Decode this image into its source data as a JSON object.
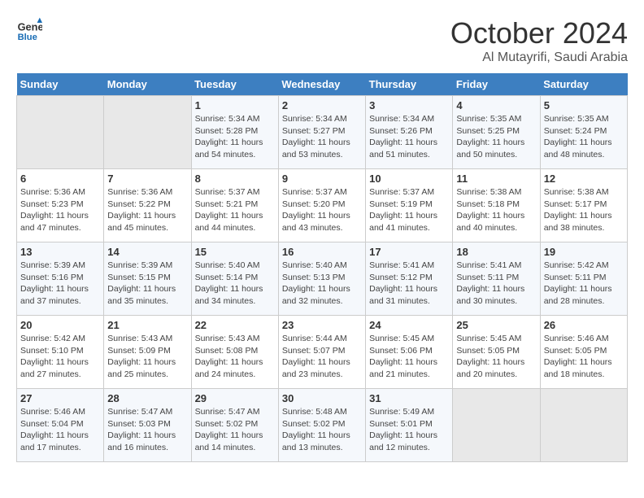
{
  "header": {
    "logo_line1": "General",
    "logo_line2": "Blue",
    "month_title": "October 2024",
    "location": "Al Mutayrifi, Saudi Arabia"
  },
  "days_of_week": [
    "Sunday",
    "Monday",
    "Tuesday",
    "Wednesday",
    "Thursday",
    "Friday",
    "Saturday"
  ],
  "weeks": [
    [
      {
        "num": "",
        "info": ""
      },
      {
        "num": "",
        "info": ""
      },
      {
        "num": "1",
        "info": "Sunrise: 5:34 AM\nSunset: 5:28 PM\nDaylight: 11 hours and 54 minutes."
      },
      {
        "num": "2",
        "info": "Sunrise: 5:34 AM\nSunset: 5:27 PM\nDaylight: 11 hours and 53 minutes."
      },
      {
        "num": "3",
        "info": "Sunrise: 5:34 AM\nSunset: 5:26 PM\nDaylight: 11 hours and 51 minutes."
      },
      {
        "num": "4",
        "info": "Sunrise: 5:35 AM\nSunset: 5:25 PM\nDaylight: 11 hours and 50 minutes."
      },
      {
        "num": "5",
        "info": "Sunrise: 5:35 AM\nSunset: 5:24 PM\nDaylight: 11 hours and 48 minutes."
      }
    ],
    [
      {
        "num": "6",
        "info": "Sunrise: 5:36 AM\nSunset: 5:23 PM\nDaylight: 11 hours and 47 minutes."
      },
      {
        "num": "7",
        "info": "Sunrise: 5:36 AM\nSunset: 5:22 PM\nDaylight: 11 hours and 45 minutes."
      },
      {
        "num": "8",
        "info": "Sunrise: 5:37 AM\nSunset: 5:21 PM\nDaylight: 11 hours and 44 minutes."
      },
      {
        "num": "9",
        "info": "Sunrise: 5:37 AM\nSunset: 5:20 PM\nDaylight: 11 hours and 43 minutes."
      },
      {
        "num": "10",
        "info": "Sunrise: 5:37 AM\nSunset: 5:19 PM\nDaylight: 11 hours and 41 minutes."
      },
      {
        "num": "11",
        "info": "Sunrise: 5:38 AM\nSunset: 5:18 PM\nDaylight: 11 hours and 40 minutes."
      },
      {
        "num": "12",
        "info": "Sunrise: 5:38 AM\nSunset: 5:17 PM\nDaylight: 11 hours and 38 minutes."
      }
    ],
    [
      {
        "num": "13",
        "info": "Sunrise: 5:39 AM\nSunset: 5:16 PM\nDaylight: 11 hours and 37 minutes."
      },
      {
        "num": "14",
        "info": "Sunrise: 5:39 AM\nSunset: 5:15 PM\nDaylight: 11 hours and 35 minutes."
      },
      {
        "num": "15",
        "info": "Sunrise: 5:40 AM\nSunset: 5:14 PM\nDaylight: 11 hours and 34 minutes."
      },
      {
        "num": "16",
        "info": "Sunrise: 5:40 AM\nSunset: 5:13 PM\nDaylight: 11 hours and 32 minutes."
      },
      {
        "num": "17",
        "info": "Sunrise: 5:41 AM\nSunset: 5:12 PM\nDaylight: 11 hours and 31 minutes."
      },
      {
        "num": "18",
        "info": "Sunrise: 5:41 AM\nSunset: 5:11 PM\nDaylight: 11 hours and 30 minutes."
      },
      {
        "num": "19",
        "info": "Sunrise: 5:42 AM\nSunset: 5:11 PM\nDaylight: 11 hours and 28 minutes."
      }
    ],
    [
      {
        "num": "20",
        "info": "Sunrise: 5:42 AM\nSunset: 5:10 PM\nDaylight: 11 hours and 27 minutes."
      },
      {
        "num": "21",
        "info": "Sunrise: 5:43 AM\nSunset: 5:09 PM\nDaylight: 11 hours and 25 minutes."
      },
      {
        "num": "22",
        "info": "Sunrise: 5:43 AM\nSunset: 5:08 PM\nDaylight: 11 hours and 24 minutes."
      },
      {
        "num": "23",
        "info": "Sunrise: 5:44 AM\nSunset: 5:07 PM\nDaylight: 11 hours and 23 minutes."
      },
      {
        "num": "24",
        "info": "Sunrise: 5:45 AM\nSunset: 5:06 PM\nDaylight: 11 hours and 21 minutes."
      },
      {
        "num": "25",
        "info": "Sunrise: 5:45 AM\nSunset: 5:05 PM\nDaylight: 11 hours and 20 minutes."
      },
      {
        "num": "26",
        "info": "Sunrise: 5:46 AM\nSunset: 5:05 PM\nDaylight: 11 hours and 18 minutes."
      }
    ],
    [
      {
        "num": "27",
        "info": "Sunrise: 5:46 AM\nSunset: 5:04 PM\nDaylight: 11 hours and 17 minutes."
      },
      {
        "num": "28",
        "info": "Sunrise: 5:47 AM\nSunset: 5:03 PM\nDaylight: 11 hours and 16 minutes."
      },
      {
        "num": "29",
        "info": "Sunrise: 5:47 AM\nSunset: 5:02 PM\nDaylight: 11 hours and 14 minutes."
      },
      {
        "num": "30",
        "info": "Sunrise: 5:48 AM\nSunset: 5:02 PM\nDaylight: 11 hours and 13 minutes."
      },
      {
        "num": "31",
        "info": "Sunrise: 5:49 AM\nSunset: 5:01 PM\nDaylight: 11 hours and 12 minutes."
      },
      {
        "num": "",
        "info": ""
      },
      {
        "num": "",
        "info": ""
      }
    ]
  ]
}
